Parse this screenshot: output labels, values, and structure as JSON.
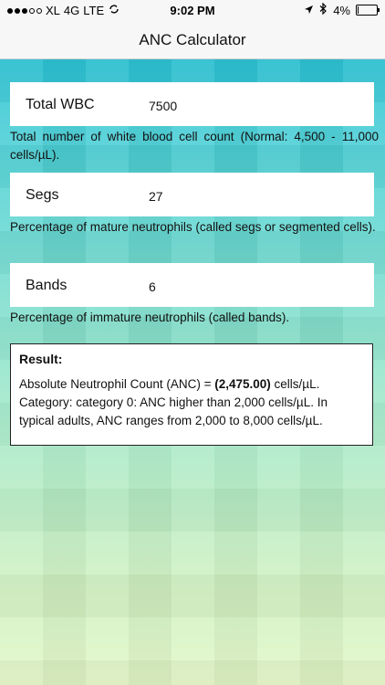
{
  "status_bar": {
    "carrier": "XL",
    "network": "4G",
    "network_type": "LTE",
    "time": "9:02 PM",
    "battery": "4%",
    "battery_level": 0.04,
    "icons": [
      "signal-dots-icon",
      "sync-icon",
      "location-arrow-icon",
      "bluetooth-icon",
      "battery-icon"
    ]
  },
  "nav": {
    "title": "ANC Calculator"
  },
  "fields": [
    {
      "label": "Total WBC",
      "value": "7500",
      "description": "Total number of white blood cell count (Normal: 4,500 - 11,000 cells/µL)."
    },
    {
      "label": "Segs",
      "value": "27",
      "description": "Percentage of mature neutrophils (called segs or segmented cells)."
    },
    {
      "label": "Bands",
      "value": "6",
      "description": "Percentage of immature neutrophils (called bands)."
    }
  ],
  "result": {
    "title": "Result:",
    "anc_prefix": "Absolute Neutrophil Count (ANC) = ",
    "anc_value": "(2,475.00)",
    "anc_unit": " cells/µL.",
    "category_text": "Category: category 0: ANC higher than 2,000 cells/µL. In typical adults, ANC ranges from 2,000 to 8,000 cells/µL."
  },
  "colors": {
    "bg_top": "#2cc4d7",
    "bg_bottom": "#e2f6c6"
  }
}
